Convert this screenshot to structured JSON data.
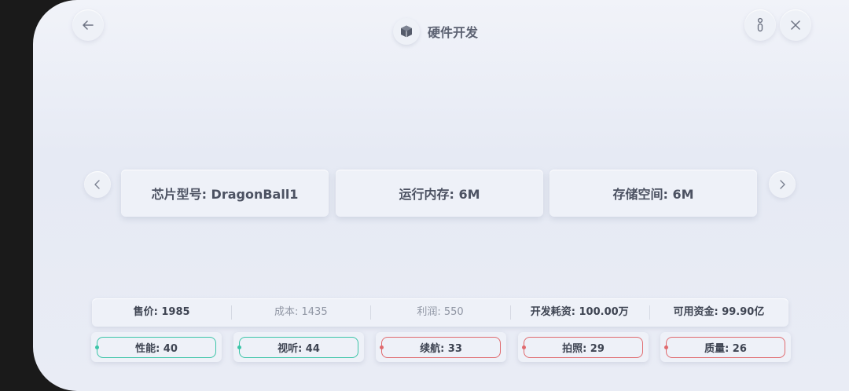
{
  "header": {
    "title": "硬件开发"
  },
  "icons": {
    "back": "arrow-left-icon",
    "title": "cube-icon",
    "info": "info-icon",
    "close": "close-icon",
    "prev": "chevron-left-icon",
    "next": "chevron-right-icon"
  },
  "specs": [
    {
      "label": "芯片型号: DragonBall1"
    },
    {
      "label": "运行内存: 6M"
    },
    {
      "label": "存储空间: 6M"
    }
  ],
  "stats": [
    {
      "label": "售价: 1985"
    },
    {
      "label": "成本: 1435"
    },
    {
      "label": "利润: 550"
    },
    {
      "label": "开发耗资: 100.00万"
    },
    {
      "label": "可用资金: 99.90亿"
    }
  ],
  "attributes": [
    {
      "label": "性能: 40",
      "status": "good",
      "color": "#3cc5a8"
    },
    {
      "label": "视听: 44",
      "status": "good",
      "color": "#3cc5a8"
    },
    {
      "label": "续航: 33",
      "status": "bad",
      "color": "#e06a6e"
    },
    {
      "label": "拍照: 29",
      "status": "bad",
      "color": "#e06a6e"
    },
    {
      "label": "质量: 26",
      "status": "bad",
      "color": "#e06a6e"
    }
  ]
}
